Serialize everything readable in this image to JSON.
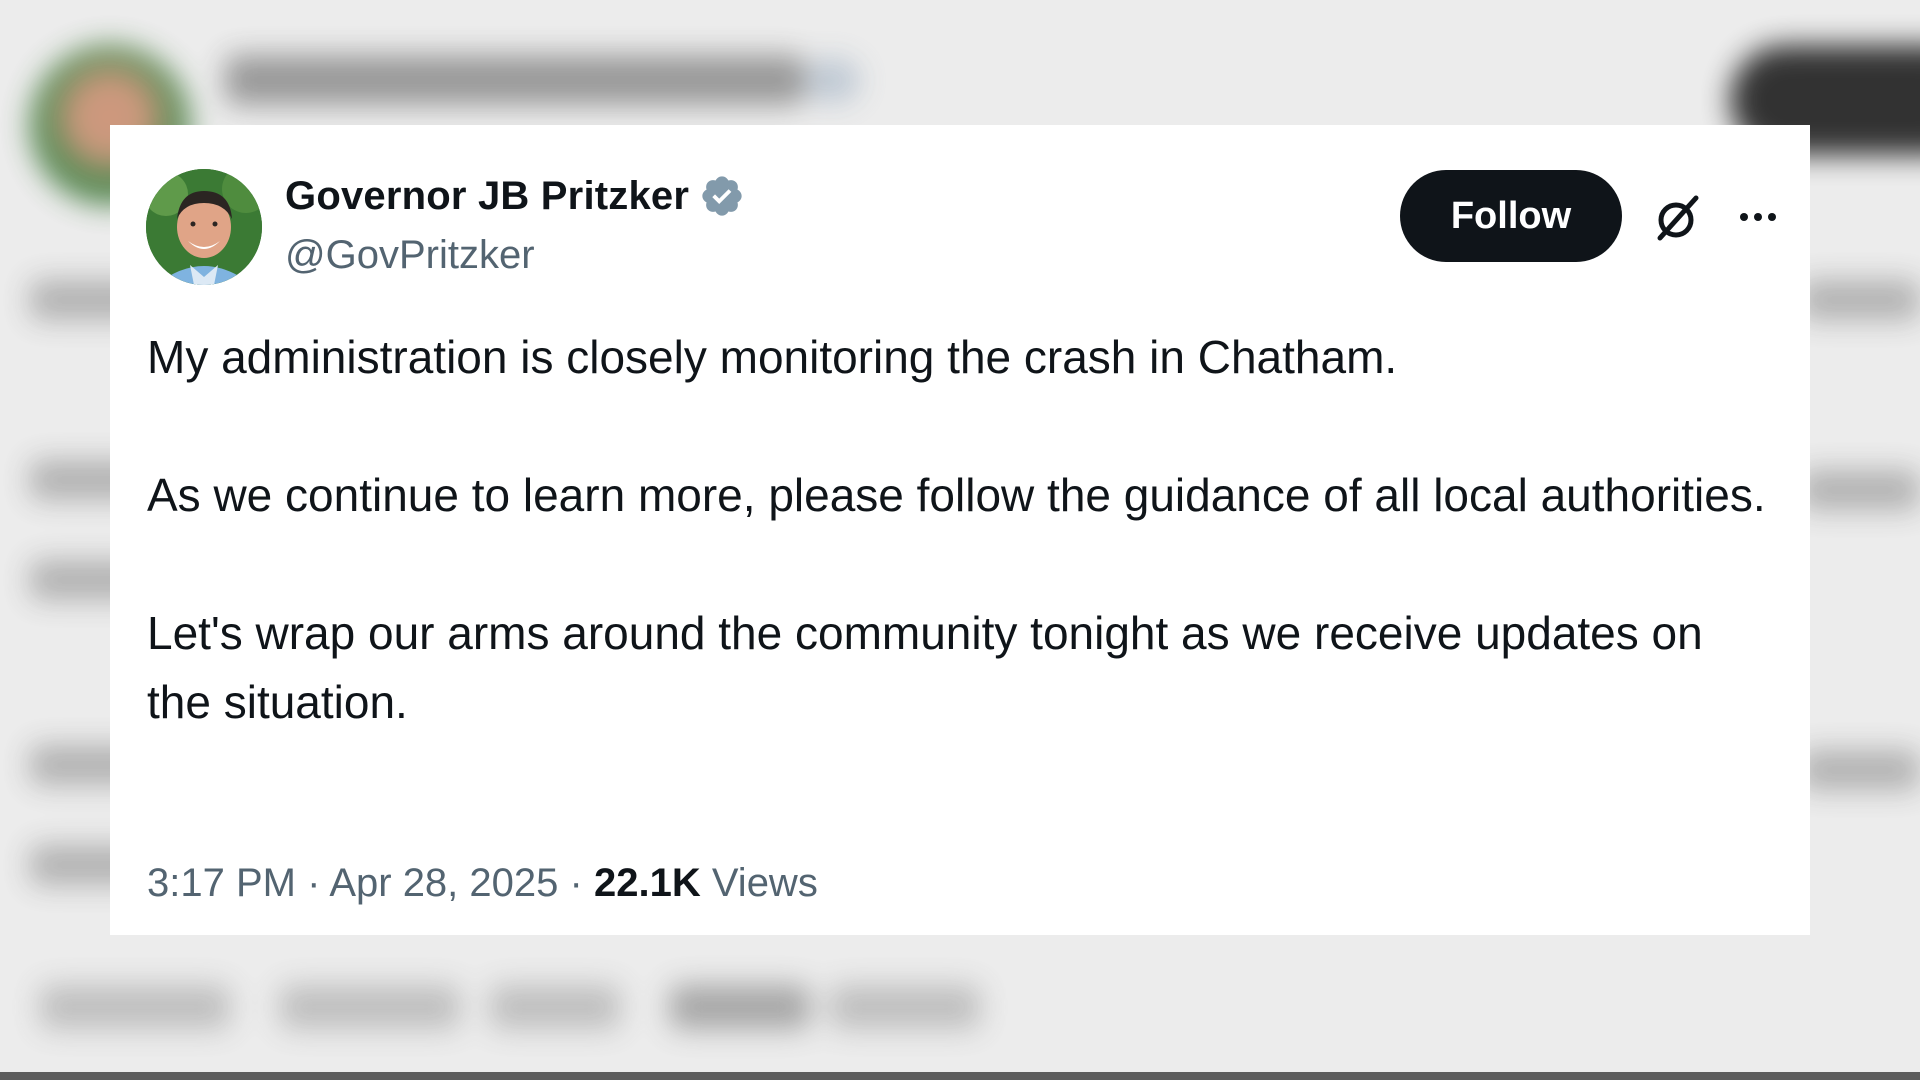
{
  "tweet": {
    "display_name": "Governor JB Pritzker",
    "handle": "@GovPritzker",
    "follow_label": "Follow",
    "paragraphs": [
      "My administration is closely monitoring the crash in Chatham.",
      "As we continue to learn more, please follow the guidance of all local authorities.",
      "Let's wrap our arms around the community tonight as we receive updates on the situation."
    ],
    "time": "3:17 PM",
    "separator": "·",
    "date": "Apr 28, 2025",
    "views_count": "22.1K",
    "views_label": "Views"
  },
  "icons": {
    "verified": "verified-badge-icon",
    "grok": "grok-icon",
    "more": "more-options-icon"
  },
  "colors": {
    "text_primary": "#0f1419",
    "text_secondary": "#536471",
    "follow_button": "#0f1419",
    "verified_badge": "#829aab",
    "card_background": "#ffffff"
  }
}
